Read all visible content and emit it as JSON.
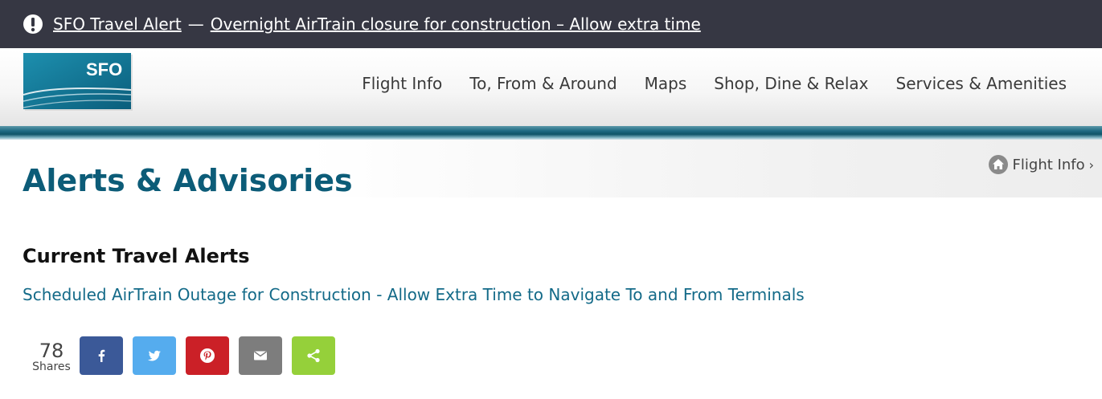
{
  "alert": {
    "icon": "exclamation-circle-icon",
    "title": "SFO Travel Alert",
    "separator": "—",
    "message": "Overnight AirTrain closure for construction – Allow extra time"
  },
  "logo": {
    "text": "SFO"
  },
  "nav": {
    "items": [
      {
        "label": "Flight Info"
      },
      {
        "label": "To, From & Around"
      },
      {
        "label": "Maps"
      },
      {
        "label": "Shop, Dine & Relax"
      },
      {
        "label": "Services & Amenities"
      }
    ]
  },
  "page": {
    "title": "Alerts & Advisories"
  },
  "breadcrumb": {
    "icon": "home-icon",
    "label": "Flight Info",
    "chevron": "›"
  },
  "content": {
    "section_title": "Current Travel Alerts",
    "alert_link": "Scheduled AirTrain Outage for Construction - Allow Extra Time to Navigate To and From Terminals"
  },
  "share": {
    "count": "78",
    "label": "Shares",
    "buttons": [
      {
        "name": "facebook",
        "icon": "facebook-icon",
        "color": "#3b5998"
      },
      {
        "name": "twitter",
        "icon": "twitter-icon",
        "color": "#55acee"
      },
      {
        "name": "pinterest",
        "icon": "pinterest-icon",
        "color": "#cb2027"
      },
      {
        "name": "email",
        "icon": "email-icon",
        "color": "#7d7d7d"
      },
      {
        "name": "share",
        "icon": "share-icon",
        "color": "#95d03a"
      }
    ]
  }
}
